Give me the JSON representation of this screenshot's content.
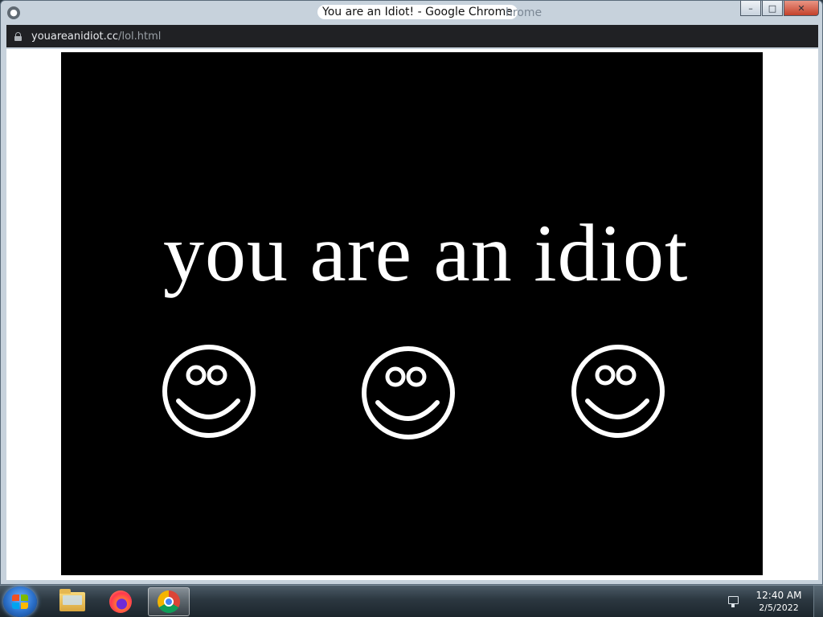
{
  "window": {
    "title": "You are an Idiot! - Google Chrome",
    "title_ghost": "hrome",
    "controls": {
      "minimize": "–",
      "maximize": "□",
      "close": "✕"
    }
  },
  "address": {
    "host": "youareanidiot.cc",
    "path": "/lol.html"
  },
  "page": {
    "headline": "you are an idiot",
    "background_color": "#000000",
    "text_color": "#ffffff",
    "smiley_count": 3
  },
  "taskbar": {
    "items": [
      "windows-explorer",
      "firefox",
      "google-chrome"
    ],
    "active_item": "google-chrome",
    "clock": {
      "time": "12:40 AM",
      "date": "2/5/2022"
    }
  }
}
